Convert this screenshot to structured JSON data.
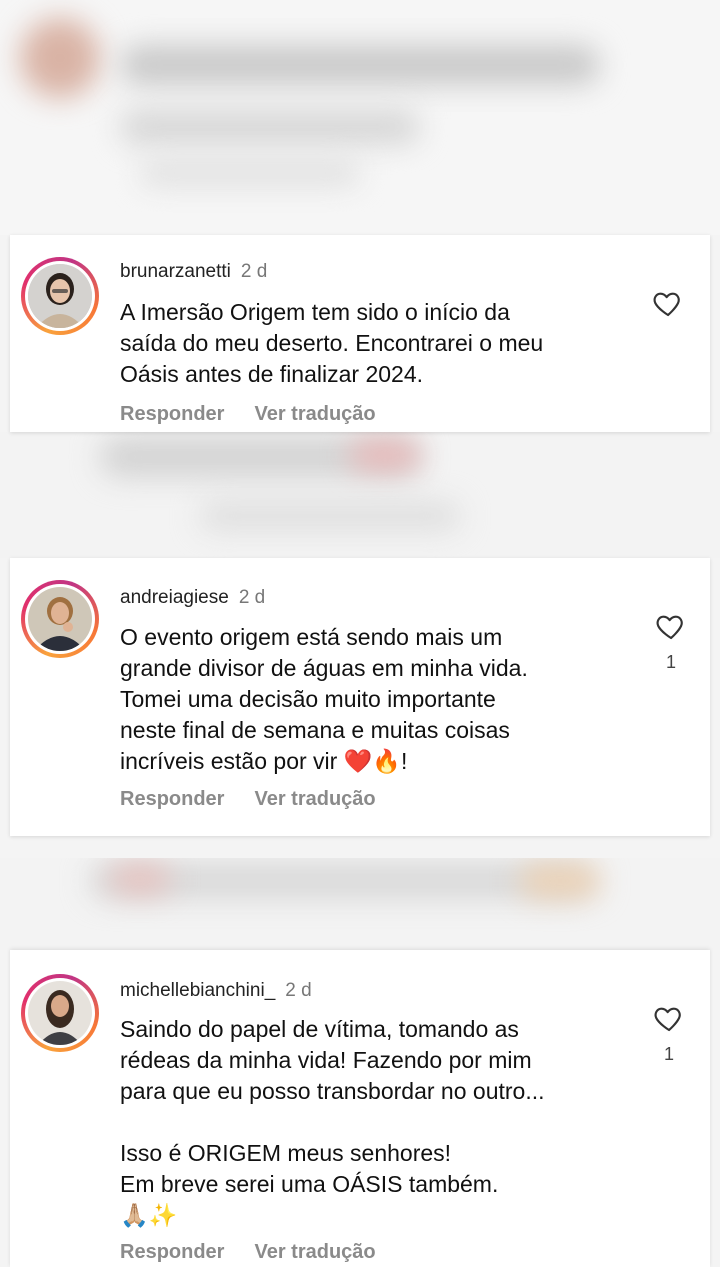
{
  "comments": [
    {
      "username": "brunarzanetti",
      "time": "2 d",
      "text": "A Imersão Origem tem sido o início da\nsaída do meu deserto. Encontrarei o meu\nOásis antes de finalizar 2024.",
      "likes": "",
      "reply_label": "Responder",
      "translate_label": "Ver tradução",
      "heart_icon": "heart-outline-icon"
    },
    {
      "username": "andreiagiese",
      "time": "2 d",
      "text": "O evento origem está sendo mais um\ngrande divisor de águas em minha vida.\nTomei uma decisão muito importante\nneste final de semana e muitas coisas\nincríveis estão por vir ❤️🔥!",
      "likes": "1",
      "reply_label": "Responder",
      "translate_label": "Ver tradução",
      "heart_icon": "heart-outline-icon"
    },
    {
      "username": "michellebianchini_",
      "time": "2 d",
      "text": "Saindo do papel de vítima, tomando as\nrédeas da minha vida! Fazendo por mim\npara que eu posso transbordar no outro...\n\nIsso é ORIGEM meus senhores!\nEm breve serei uma OÁSIS também.\n🙏🏼✨",
      "likes": "1",
      "reply_label": "Responder",
      "translate_label": "Ver tradução",
      "heart_icon": "heart-outline-icon"
    }
  ],
  "colors": {
    "story_ring_start": "#f9a23c",
    "story_ring_end": "#c13584",
    "secondary_text": "#8a8a8a"
  }
}
